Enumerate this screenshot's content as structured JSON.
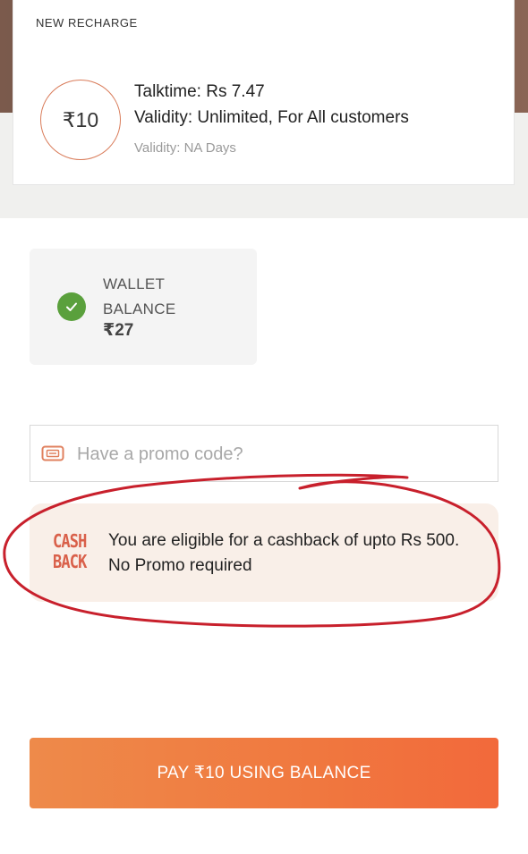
{
  "recharge": {
    "heading": "NEW RECHARGE",
    "amount": "₹10",
    "talktime": "Talktime: Rs 7.47",
    "validity": "Validity: Unlimited, For All customers",
    "validity_days": "Validity: NA Days"
  },
  "wallet": {
    "label": "WALLET BALANCE",
    "amount": "₹27",
    "selected": true
  },
  "promo": {
    "placeholder": "Have a promo code?",
    "value": ""
  },
  "cashback": {
    "logo_text": "CASH BACK",
    "message": "You are eligible for a cashback of upto Rs 500. No Promo required"
  },
  "pay": {
    "label": "PAY ₹10 USING BALANCE"
  },
  "colors": {
    "accent": "#f07a40",
    "cashback_bg": "#f9efe8",
    "check_green": "#5aa03c",
    "annotation_red": "#c8202c"
  },
  "icons": {
    "selected": "check-circle-icon",
    "promo": "ticket-icon"
  }
}
